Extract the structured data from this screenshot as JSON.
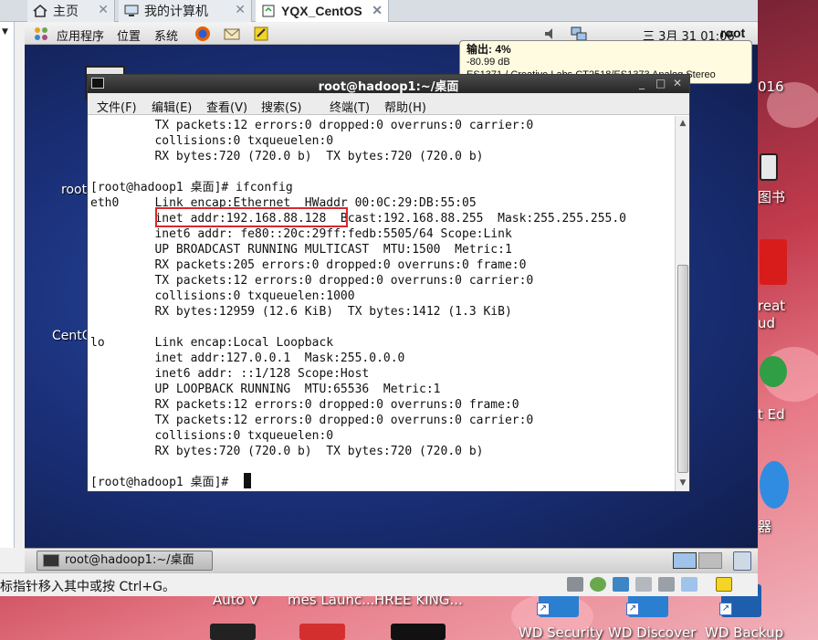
{
  "vm_tabs": [
    {
      "label": "主页"
    },
    {
      "label": "我的计算机"
    },
    {
      "label": "YQX_CentOS"
    }
  ],
  "guest_panel": {
    "menus": [
      "应用程序",
      "位置",
      "系统"
    ],
    "clock": "三 3月 31 01:06",
    "user": "root"
  },
  "volume_tooltip": {
    "title": "输出:  4%",
    "db": "-80.99 dB",
    "device": "ES1371 / Creative Labs CT2518/ES1373 Analog Stereo"
  },
  "terminal": {
    "title": "root@hadoop1:~/桌面",
    "menus": [
      "文件(F)",
      "编辑(E)",
      "查看(V)",
      "搜索(S)",
      "终端(T)",
      "帮助(H)"
    ],
    "lines": [
      "         TX packets:12 errors:0 dropped:0 overruns:0 carrier:0",
      "         collisions:0 txqueuelen:0",
      "         RX bytes:720 (720.0 b)  TX bytes:720 (720.0 b)",
      "",
      "[root@hadoop1 桌面]# ifconfig",
      "eth0     Link encap:Ethernet  HWaddr 00:0C:29:DB:55:05",
      "         inet addr:192.168.88.128  Bcast:192.168.88.255  Mask:255.255.255.0",
      "         inet6 addr: fe80::20c:29ff:fedb:5505/64 Scope:Link",
      "         UP BROADCAST RUNNING MULTICAST  MTU:1500  Metric:1",
      "         RX packets:205 errors:0 dropped:0 overruns:0 frame:0",
      "         TX packets:12 errors:0 dropped:0 overruns:0 carrier:0",
      "         collisions:0 txqueuelen:1000",
      "         RX bytes:12959 (12.6 KiB)  TX bytes:1412 (1.3 KiB)",
      "",
      "lo       Link encap:Local Loopback",
      "         inet addr:127.0.0.1  Mask:255.0.0.0",
      "         inet6 addr: ::1/128 Scope:Host",
      "         UP LOOPBACK RUNNING  MTU:65536  Metric:1",
      "         RX packets:12 errors:0 dropped:0 overruns:0 frame:0",
      "         TX packets:12 errors:0 dropped:0 overruns:0 carrier:0",
      "         collisions:0 txqueuelen:0",
      "         RX bytes:720 (720.0 b)  TX bytes:720 (720.0 b)",
      "",
      "[root@hadoop1 桌面]# "
    ]
  },
  "guest_desktop_labels": [
    "root",
    "CentO"
  ],
  "guest_taskbar": {
    "window_button": "root@hadoop1:~/桌面"
  },
  "vm_status_text": "标指针移入其中或按 Ctrl+G。",
  "host_desktop": {
    "right_labels": [
      "016",
      "图书",
      "reat",
      "ud",
      "t Ed",
      "器"
    ],
    "bottom_labels": [
      "Auto V",
      "mes Launc...",
      "HREE KING...",
      "WD Security",
      "WD Discover",
      "WD Backup"
    ]
  },
  "colors": {
    "highlight": "#d8282f",
    "terminal_titlebar": "#262626",
    "guest_desktop": "#1a2f78"
  }
}
